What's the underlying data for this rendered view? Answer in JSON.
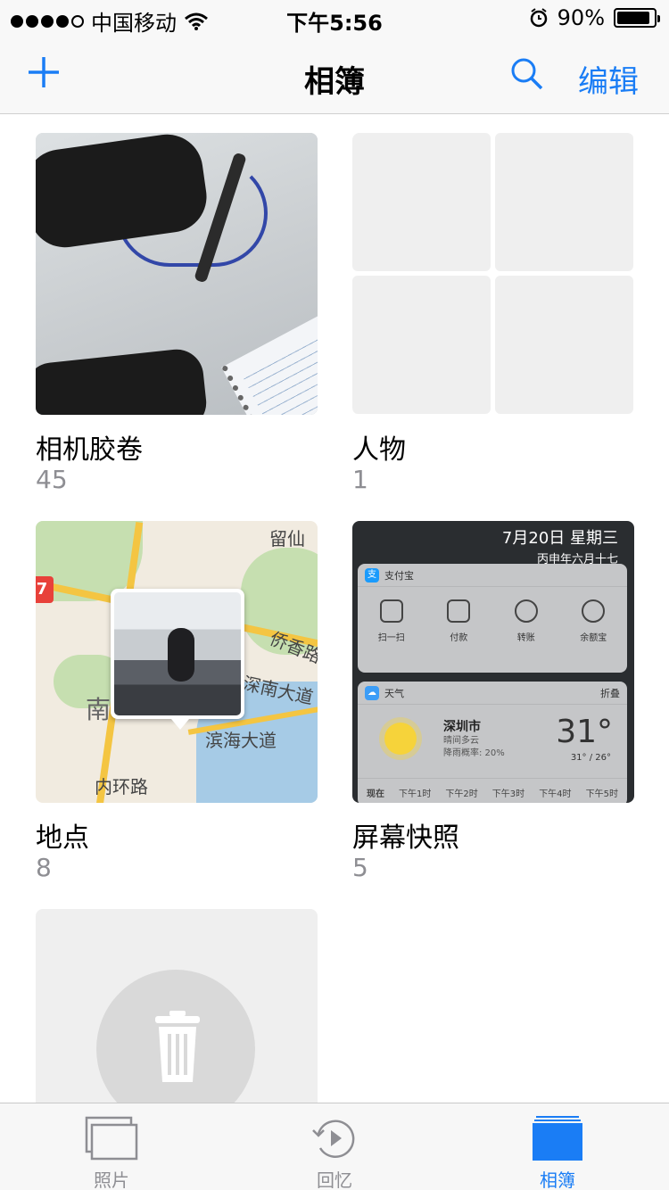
{
  "status_bar": {
    "carrier": "中国移动",
    "time": "下午5:56",
    "battery": "90%",
    "battery_level": 0.9
  },
  "nav": {
    "title": "相簿",
    "edit_label": "编辑",
    "add_icon": "plus-icon",
    "search_icon": "search-icon"
  },
  "albums": [
    {
      "name": "相机胶卷",
      "count": "45"
    },
    {
      "name": "人物",
      "count": "1"
    },
    {
      "name": "地点",
      "count": "8"
    },
    {
      "name": "屏幕快照",
      "count": "5"
    }
  ],
  "map_labels": {
    "top_right": "留仙",
    "road_a": "侨香路",
    "road_b": "深南大道",
    "road_c": "滨海大道",
    "road_d": "内环路",
    "district": "南",
    "badge": "7"
  },
  "screenshot_preview": {
    "date": "7月20日 星期三",
    "lunar": "丙申年六月十七",
    "alipay_title": "支付宝",
    "alipay_icon": "支",
    "actions": [
      "扫一扫",
      "付款",
      "转账",
      "余额宝"
    ],
    "weather_title": "天气",
    "weather_fold": "折叠",
    "city": "深圳市",
    "condition": "晴间多云",
    "rain": "降雨概率: 20%",
    "temp": "31°",
    "range": "31° / 26°",
    "hours": [
      "现在",
      "下午1时",
      "下午2时",
      "下午3时",
      "下午4时",
      "下午5时"
    ]
  },
  "tabs": [
    {
      "label": "照片",
      "icon": "photos-icon"
    },
    {
      "label": "回忆",
      "icon": "memories-icon"
    },
    {
      "label": "相簿",
      "icon": "albums-icon"
    }
  ],
  "colors": {
    "accent": "#1a7df5",
    "secondary_text": "#8e8e93"
  }
}
